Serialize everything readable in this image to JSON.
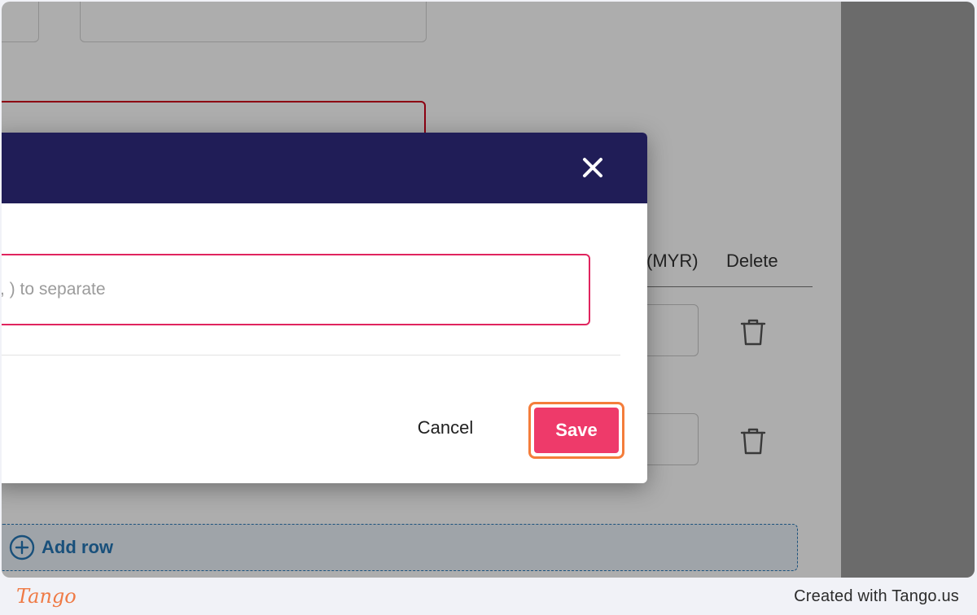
{
  "background": {
    "columns": {
      "currency": "(MYR)",
      "delete": "Delete"
    },
    "add_row_label": "Add row"
  },
  "modal": {
    "input_text": ", ) to separate",
    "cancel_label": "Cancel",
    "save_label": "Save",
    "header_color": "#201d57",
    "accent_color": "#ee3a6a",
    "highlight_color": "#f47d3b"
  },
  "footer": {
    "logo": "Tango",
    "credit": "Created with Tango.us"
  }
}
